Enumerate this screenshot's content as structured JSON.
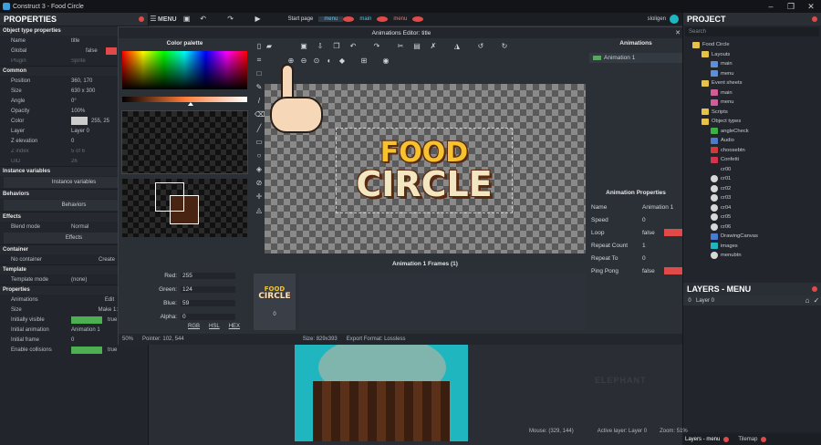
{
  "window": {
    "title": "Construct 3 - Food Circle",
    "min": "–",
    "max": "❐",
    "close": "✕"
  },
  "properties": {
    "title": "PROPERTIES",
    "sections": [
      {
        "header": "Object type properties",
        "rows": [
          [
            "Name",
            "title"
          ],
          [
            "Global",
            "false"
          ],
          [
            "Plugin",
            "Sprite"
          ]
        ]
      },
      {
        "header": "Common",
        "rows": [
          [
            "Position",
            "360, 170"
          ],
          [
            "Size",
            "630 x 300"
          ],
          [
            "Angle",
            "0°"
          ],
          [
            "Opacity",
            "100%"
          ],
          [
            "Color",
            "255, 25"
          ],
          [
            "Layer",
            "Layer 0"
          ],
          [
            "Z elevation",
            "0"
          ],
          [
            "Z index",
            "5 of 6"
          ],
          [
            "UID",
            "26"
          ]
        ]
      }
    ],
    "instance_variables": "Instance variables",
    "instance_variables_btn": "Instance variables",
    "behaviors": "Behaviors",
    "behaviors_btn": "Behaviors",
    "effects": "Effects",
    "blend_mode_label": "Blend mode",
    "blend_mode": "Normal",
    "effects_btn": "Effects",
    "container": "Container",
    "no_container": "No container",
    "create": "Create",
    "template": "Template",
    "template_mode_label": "Template mode",
    "template_mode": "(none)",
    "props": "Properties",
    "rows2": [
      [
        "Animations",
        "Edit"
      ],
      [
        "Size",
        "Make 1:1"
      ],
      [
        "Initially visible",
        "true"
      ],
      [
        "Initial animation",
        "Animation 1"
      ],
      [
        "Initial frame",
        "0"
      ],
      [
        "Enable collisions",
        "true"
      ]
    ]
  },
  "menubar": {
    "menu": "MENU",
    "start_page": "Start page",
    "tabs": [
      "menu",
      "main",
      "menu"
    ],
    "user": "sloligen"
  },
  "dialog": {
    "title": "Animations Editor: title",
    "close": "✕",
    "color_palette": "Color palette",
    "rgb": {
      "red_label": "Red:",
      "red": "255",
      "green_label": "Green:",
      "green": "124",
      "blue_label": "Blue:",
      "blue": "59",
      "alpha_label": "Alpha:",
      "alpha": "0"
    },
    "modes": [
      "RGB",
      "HSL",
      "HEX"
    ],
    "zoom": "50%",
    "pointer": "Pointer: 102, 544",
    "size_info": "Size: 829x393",
    "export": "Export Format: Lossless",
    "logo_top": "FOOD",
    "logo_bottom": "CIRCLE",
    "frames_title": "Animation 1 Frames (1)",
    "frame_index": "0",
    "animations_title": "Animations",
    "animation_item": "Animation 1",
    "anim_props_title": "Animation Properties",
    "anim_props": [
      [
        "Name",
        "Animation 1"
      ],
      [
        "Speed",
        "0"
      ],
      [
        "Loop",
        "false"
      ],
      [
        "Repeat Count",
        "1"
      ],
      [
        "Repeat To",
        "0"
      ],
      [
        "Ping Pong",
        "false"
      ]
    ]
  },
  "colors": {
    "accent": "#e04a48",
    "green": "#4caf50",
    "brown": "#4a2412",
    "teal": "#1fb6c0",
    "fg_color": "#ff7c3b"
  },
  "project": {
    "title": "PROJECT",
    "search": "Search",
    "items": [
      {
        "label": "Food Circle",
        "indent": 1,
        "icon": "folder"
      },
      {
        "label": "Layouts",
        "indent": 2,
        "icon": "folder"
      },
      {
        "label": "main",
        "indent": 3,
        "icon": "layout"
      },
      {
        "label": "menu",
        "indent": 3,
        "icon": "layout"
      },
      {
        "label": "Event sheets",
        "indent": 2,
        "icon": "folder"
      },
      {
        "label": "main",
        "indent": 3,
        "icon": "event"
      },
      {
        "label": "menu",
        "indent": 3,
        "icon": "event"
      },
      {
        "label": "Scripts",
        "indent": 2,
        "icon": "folder"
      },
      {
        "label": "Object types",
        "indent": 2,
        "icon": "folder"
      },
      {
        "label": "angleCheck",
        "indent": 3,
        "icon": "green"
      },
      {
        "label": "Audio",
        "indent": 3,
        "icon": "audio"
      },
      {
        "label": "choosebtn",
        "indent": 3,
        "icon": "red"
      },
      {
        "label": "Confetti",
        "indent": 3,
        "icon": "confetti"
      },
      {
        "label": "cr00",
        "indent": 3,
        "icon": "none"
      },
      {
        "label": "cr01",
        "indent": 3,
        "icon": "circle"
      },
      {
        "label": "cr02",
        "indent": 3,
        "icon": "circle"
      },
      {
        "label": "cr03",
        "indent": 3,
        "icon": "circle"
      },
      {
        "label": "cr04",
        "indent": 3,
        "icon": "circle"
      },
      {
        "label": "cr05",
        "indent": 3,
        "icon": "circle"
      },
      {
        "label": "cr06",
        "indent": 3,
        "icon": "circle"
      },
      {
        "label": "DrawingCanvas",
        "indent": 3,
        "icon": "canvas"
      },
      {
        "label": "images",
        "indent": 3,
        "icon": "images"
      },
      {
        "label": "menubtn",
        "indent": 3,
        "icon": "circle"
      }
    ]
  },
  "layers": {
    "title": "LAYERS - MENU",
    "row_index": "0",
    "row_name": "Layer 0"
  },
  "statusbar": {
    "mouse": "Mouse: (329, 144)",
    "active_layer": "Active layer: Layer 0",
    "zoom": "Zoom: 51%",
    "tab1": "Layers - menu",
    "tab2": "Tilemap"
  },
  "watermark": "ELEPHANT"
}
